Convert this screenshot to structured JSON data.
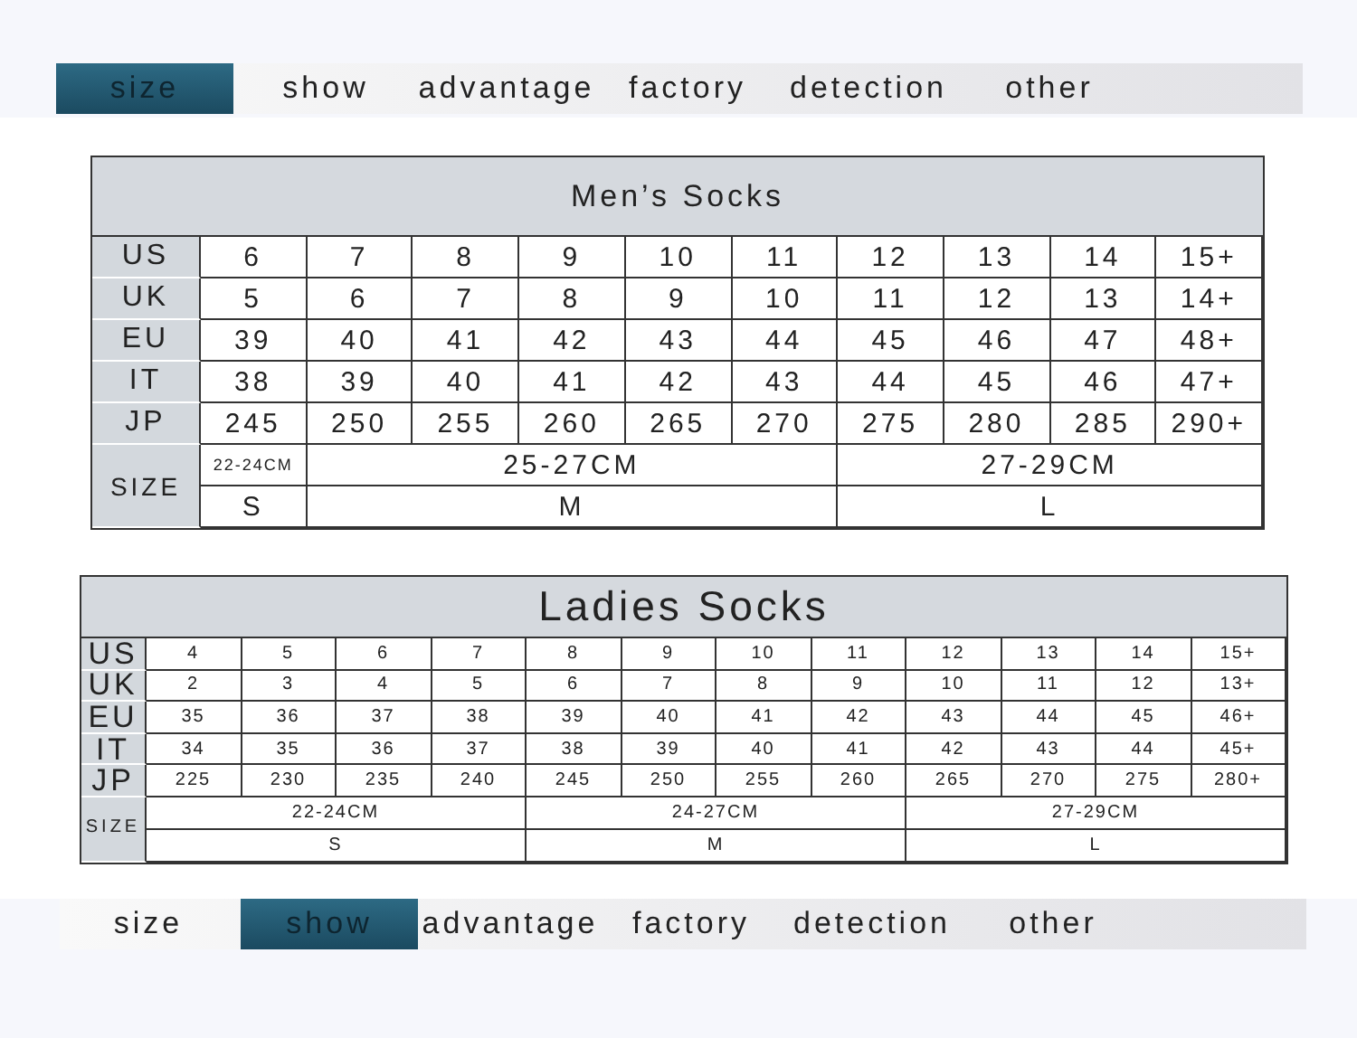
{
  "top_nav": [
    {
      "label": "size",
      "selected": true
    },
    {
      "label": "show",
      "selected": false
    },
    {
      "label": "advantage",
      "selected": false
    },
    {
      "label": "factory",
      "selected": false
    },
    {
      "label": "detection",
      "selected": false
    },
    {
      "label": "other",
      "selected": false
    }
  ],
  "tables": [
    {
      "title": "Men’s Socks",
      "rows": [
        {
          "label": "US",
          "cells": [
            "6",
            "7",
            "8",
            "9",
            "10",
            "11",
            "12",
            "13",
            "14",
            "15+"
          ]
        },
        {
          "label": "UK",
          "cells": [
            "5",
            "6",
            "7",
            "8",
            "9",
            "10",
            "11",
            "12",
            "13",
            "14+"
          ]
        },
        {
          "label": "EU",
          "cells": [
            "39",
            "40",
            "41",
            "42",
            "43",
            "44",
            "45",
            "46",
            "47",
            "48+"
          ]
        },
        {
          "label": "IT",
          "cells": [
            "38",
            "39",
            "40",
            "41",
            "42",
            "43",
            "44",
            "45",
            "46",
            "47+"
          ]
        },
        {
          "label": "JP",
          "cells": [
            "245",
            "250",
            "255",
            "260",
            "265",
            "270",
            "275",
            "280",
            "285",
            "290+"
          ]
        }
      ],
      "size_label": "SIZE",
      "groups": [
        {
          "range": "22-24CM",
          "size": "S"
        },
        {
          "range": "25-27CM",
          "size": "M"
        },
        {
          "range": "27-29CM",
          "size": "L"
        }
      ]
    },
    {
      "title": "Ladies Socks",
      "rows": [
        {
          "label": "US",
          "cells": [
            "4",
            "5",
            "6",
            "7",
            "8",
            "9",
            "10",
            "11",
            "12",
            "13",
            "14",
            "15+"
          ]
        },
        {
          "label": "UK",
          "cells": [
            "2",
            "3",
            "4",
            "5",
            "6",
            "7",
            "8",
            "9",
            "10",
            "11",
            "12",
            "13+"
          ]
        },
        {
          "label": "EU",
          "cells": [
            "35",
            "36",
            "37",
            "38",
            "39",
            "40",
            "41",
            "42",
            "43",
            "44",
            "45",
            "46+"
          ]
        },
        {
          "label": "IT",
          "cells": [
            "34",
            "35",
            "36",
            "37",
            "38",
            "39",
            "40",
            "41",
            "42",
            "43",
            "44",
            "45+"
          ]
        },
        {
          "label": "JP",
          "cells": [
            "225",
            "230",
            "235",
            "240",
            "245",
            "250",
            "255",
            "260",
            "265",
            "270",
            "275",
            "280+"
          ]
        }
      ],
      "size_label": "SIZE",
      "groups": [
        {
          "range": "22-24CM",
          "size": "S"
        },
        {
          "range": "24-27CM",
          "size": "M"
        },
        {
          "range": "27-29CM",
          "size": "L"
        }
      ]
    }
  ],
  "bottom_nav": [
    {
      "label": "size",
      "selected": false
    },
    {
      "label": "show",
      "selected": true
    },
    {
      "label": "advantage",
      "selected": false
    },
    {
      "label": "factory",
      "selected": false
    },
    {
      "label": "detection",
      "selected": false
    },
    {
      "label": "other",
      "selected": false
    }
  ]
}
